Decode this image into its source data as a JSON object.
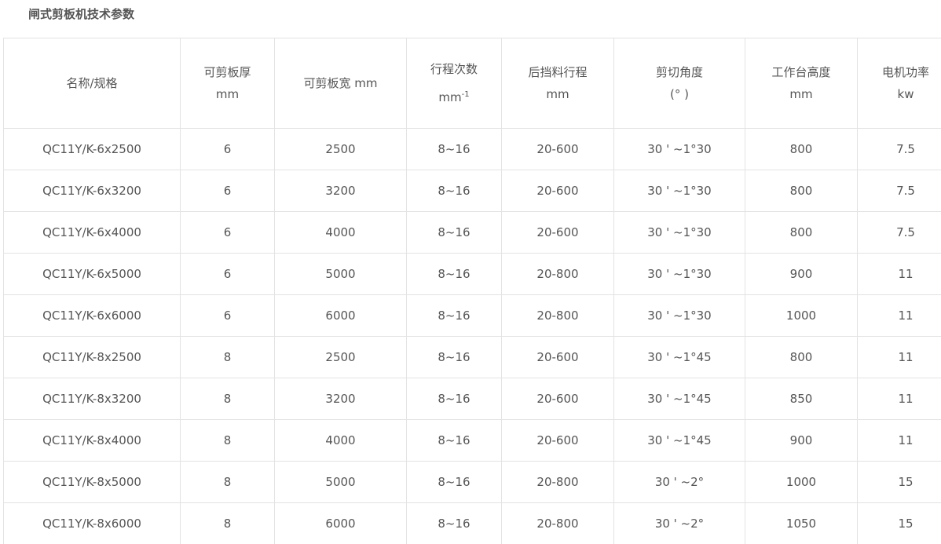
{
  "title": "闸式剪板机技术参数",
  "header": {
    "name": "名称/规格",
    "thickness": [
      "可剪板厚",
      "mm"
    ],
    "width": "可剪板宽 mm",
    "strokes": [
      "行程次数",
      "mm",
      "-1"
    ],
    "backgauge": [
      "后挡料行程",
      "mm"
    ],
    "angle": [
      "剪切角度",
      "(° )"
    ],
    "table_height": [
      "工作台高度",
      "mm"
    ],
    "power": [
      "电机功率",
      "kw"
    ]
  },
  "rows": [
    [
      "QC11Y/K-6x2500",
      "6",
      "2500",
      "8~16",
      "20-600",
      "30 ' ~1°30",
      "800",
      "7.5"
    ],
    [
      "QC11Y/K-6x3200",
      "6",
      "3200",
      "8~16",
      "20-600",
      "30 ' ~1°30",
      "800",
      "7.5"
    ],
    [
      "QC11Y/K-6x4000",
      "6",
      "4000",
      "8~16",
      "20-600",
      "30 ' ~1°30",
      "800",
      "7.5"
    ],
    [
      "QC11Y/K-6x5000",
      "6",
      "5000",
      "8~16",
      "20-800",
      "30 ' ~1°30",
      "900",
      "11"
    ],
    [
      "QC11Y/K-6x6000",
      "6",
      "6000",
      "8~16",
      "20-800",
      "30 ' ~1°30",
      "1000",
      "11"
    ],
    [
      "QC11Y/K-8x2500",
      "8",
      "2500",
      "8~16",
      "20-600",
      "30 ' ~1°45",
      "800",
      "11"
    ],
    [
      "QC11Y/K-8x3200",
      "8",
      "3200",
      "8~16",
      "20-600",
      "30 ' ~1°45",
      "850",
      "11"
    ],
    [
      "QC11Y/K-8x4000",
      "8",
      "4000",
      "8~16",
      "20-600",
      "30 ' ~1°45",
      "900",
      "11"
    ],
    [
      "QC11Y/K-8x5000",
      "8",
      "5000",
      "8~16",
      "20-800",
      "30 ' ~2°",
      "1000",
      "15"
    ],
    [
      "QC11Y/K-8x6000",
      "8",
      "6000",
      "8~16",
      "20-800",
      "30 ' ~2°",
      "1050",
      "15"
    ]
  ]
}
